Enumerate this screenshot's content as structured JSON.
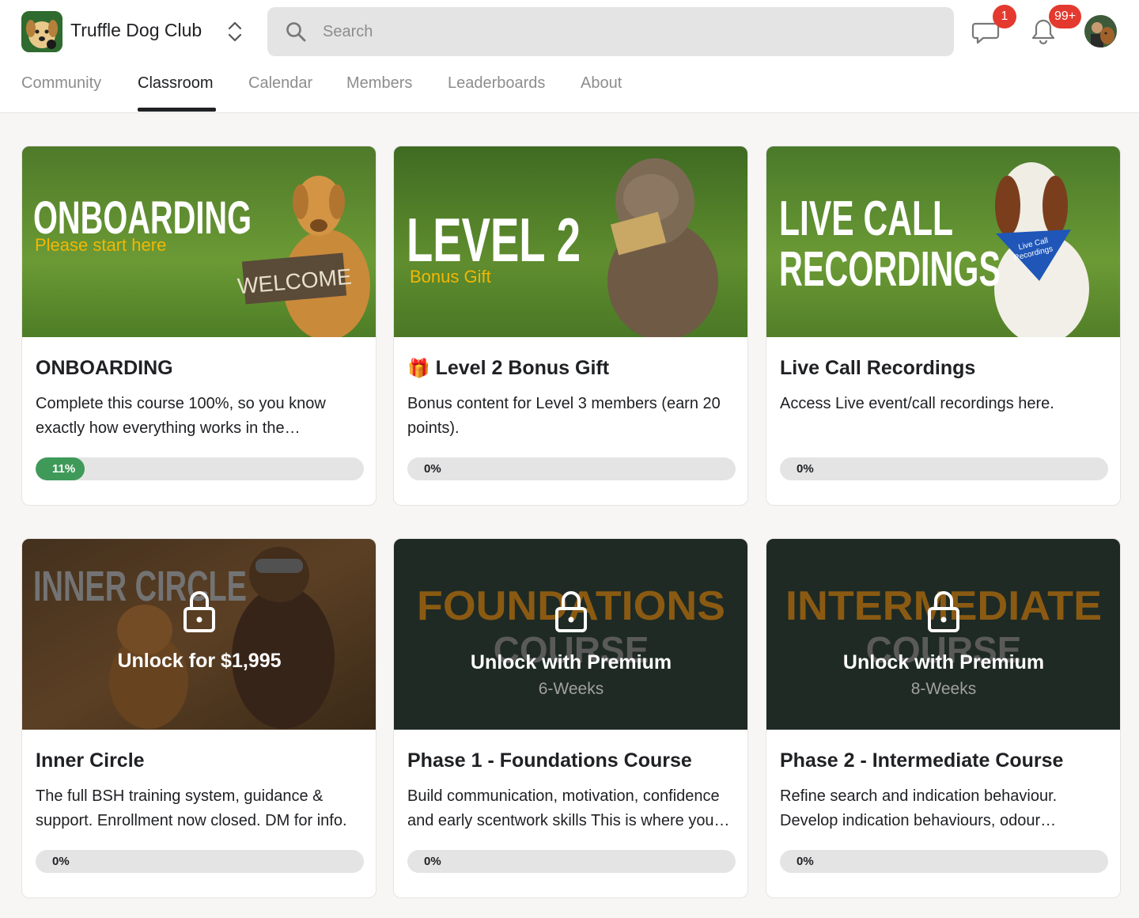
{
  "header": {
    "brand": "Truffle Dog Club",
    "search_placeholder": "Search",
    "chat_badge": "1",
    "notif_badge": "99+"
  },
  "tabs": [
    {
      "label": "Community",
      "active": false
    },
    {
      "label": "Classroom",
      "active": true
    },
    {
      "label": "Calendar",
      "active": false
    },
    {
      "label": "Members",
      "active": false
    },
    {
      "label": "Leaderboards",
      "active": false
    },
    {
      "label": "About",
      "active": false
    }
  ],
  "colors": {
    "accent_green": "#3f9a59",
    "badge_red": "#e4392e",
    "cover_title_gold": "#f2b705",
    "locked_title_gold": "#8b5a12"
  },
  "courses": [
    {
      "cover_title": "ONBOARDING",
      "cover_subtitle": "Please start here",
      "cover_sign": "WELCOME",
      "title": "ONBOARDING",
      "description": "Complete this course 100%, so you know exactly how everything works in the…",
      "progress": 11,
      "progress_label": "11%",
      "locked": false
    },
    {
      "cover_title": "LEVEL 2",
      "cover_subtitle": "Bonus Gift",
      "title_icon": "gift-icon",
      "title": "Level 2 Bonus Gift",
      "description": "Bonus content for Level 3 members (earn 20 points).",
      "progress": 0,
      "progress_label": "0%",
      "locked": false
    },
    {
      "cover_title_line1": "LIVE CALL",
      "cover_title_line2": "RECORDINGS",
      "cover_bandana_line1": "Live Call",
      "cover_bandana_line2": "Recordings",
      "title": "Live Call Recordings",
      "description": "Access Live event/call recordings here.",
      "progress": 0,
      "progress_label": "0%",
      "locked": false
    },
    {
      "cover_title": "INNER CIRCLE",
      "lock_label": "Unlock for $1,995",
      "title": "Inner Circle",
      "description": "The full BSH training system, guidance & support. Enrollment now closed. DM for info.",
      "progress": 0,
      "progress_label": "0%",
      "locked": true
    },
    {
      "cover_title_line1": "FOUNDATIONS",
      "cover_title_line2": "COURSE",
      "cover_duration": "6-Weeks",
      "lock_label": "Unlock with Premium",
      "title": "Phase 1 - Foundations Course",
      "description": "Build communication, motivation, confidence and early scentwork skills This is where you…",
      "progress": 0,
      "progress_label": "0%",
      "locked": true
    },
    {
      "cover_title_line1": "INTERMEDIATE",
      "cover_title_line2": "COURSE",
      "cover_duration": "8-Weeks",
      "lock_label": "Unlock with Premium",
      "title": "Phase 2 - Intermediate Course",
      "description": "Refine search and indication behaviour. Develop indication behaviours, odour…",
      "progress": 0,
      "progress_label": "0%",
      "locked": true
    }
  ]
}
